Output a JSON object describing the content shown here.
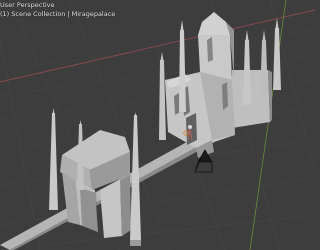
{
  "viewport": {
    "view_mode_label": "User Perspective",
    "collection_label": "(1) Scene Collection | Miragepalace"
  },
  "colors": {
    "background": "#3d3d3d",
    "grid": "#474747",
    "axis_x": "#8a4a4f",
    "axis_y": "#6a8a3a",
    "model_light": "#c8c8c8",
    "model_mid": "#a8a8a8",
    "model_dark": "#7c7c7c"
  },
  "icons": {
    "camera": "camera-icon",
    "origin": "origin-marker-icon"
  }
}
